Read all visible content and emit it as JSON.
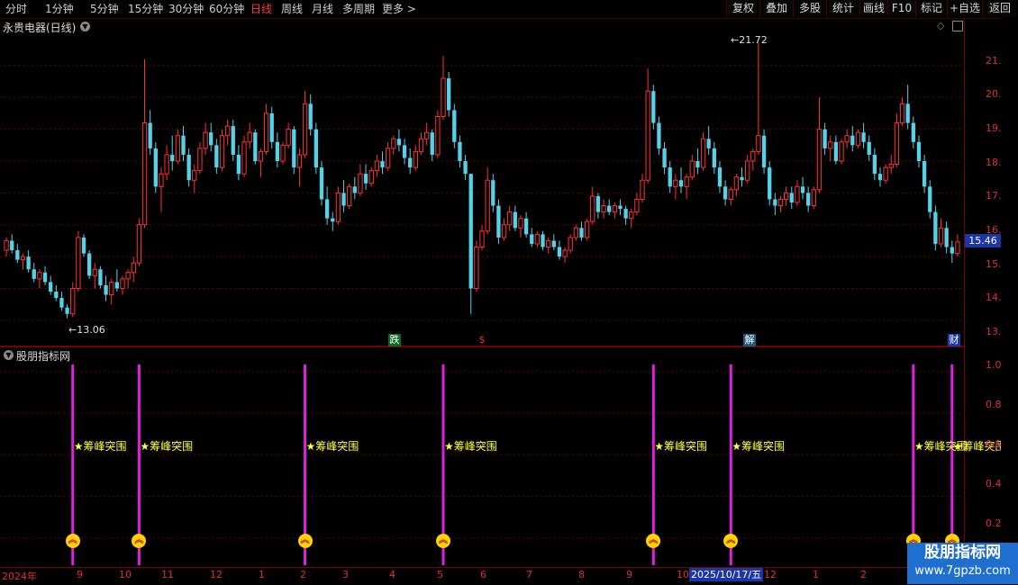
{
  "toolbar": {
    "timeframes": [
      "分时",
      "1分钟",
      "5分钟",
      "15分钟",
      "30分钟",
      "60分钟",
      "日线",
      "周线",
      "月线",
      "多周期",
      "更多"
    ],
    "active_timeframe": "日线",
    "buttons": [
      "复权",
      "叠加",
      "多股",
      "统计",
      "画线",
      "F10",
      "标记",
      "+自选",
      "返回"
    ]
  },
  "main_chart": {
    "stock_title": "永贵电器(日线)",
    "price_labels": [
      "21.00",
      "20.00",
      "19.00",
      "18.00",
      "17.00",
      "16.00",
      "15.00",
      "14.00",
      "13.00"
    ],
    "current_price": "15.46",
    "high_marker": "21.72",
    "low_marker": "13.06",
    "event_markers": [
      "跌",
      "$",
      "解",
      "财"
    ]
  },
  "indicator": {
    "title": "股朋指标网",
    "scale_labels": [
      "1.00",
      "0.80",
      "0.60",
      "0.40",
      "0.20"
    ],
    "signal_label": "★筹峰突围",
    "signal_count": 8
  },
  "x_axis": {
    "labels": [
      "2024年",
      "9",
      "10",
      "11",
      "12",
      "1",
      "2",
      "3",
      "4",
      "5",
      "6",
      "7",
      "8",
      "9",
      "10",
      "11",
      "12",
      "1",
      "2"
    ],
    "selected_date": "2025/10/17/五"
  },
  "watermark": {
    "line1": "股朋指标网",
    "line2": "www.7gpzb.com"
  },
  "colors": {
    "up": "#ff3232",
    "down": "#54d2e8",
    "signal": "#e020e0",
    "label": "#ffff40",
    "axis": "#e03030"
  },
  "chart_data": {
    "type": "candlestick",
    "title": "永贵电器(日线)",
    "y_range": [
      12.6,
      22.1
    ],
    "candles": [
      [
        15.2,
        15.6,
        15.0,
        15.5
      ],
      [
        15.5,
        15.7,
        15.1,
        15.2
      ],
      [
        15.2,
        15.4,
        14.8,
        14.9
      ],
      [
        14.9,
        15.1,
        14.6,
        15.0
      ],
      [
        15.0,
        15.2,
        14.5,
        14.6
      ],
      [
        14.6,
        14.8,
        14.2,
        14.3
      ],
      [
        14.3,
        14.6,
        14.0,
        14.5
      ],
      [
        14.5,
        14.7,
        14.1,
        14.2
      ],
      [
        14.2,
        14.4,
        13.8,
        13.9
      ],
      [
        13.9,
        14.1,
        13.6,
        13.7
      ],
      [
        13.7,
        13.9,
        13.3,
        13.4
      ],
      [
        13.4,
        13.5,
        13.06,
        13.2
      ],
      [
        13.2,
        14.2,
        13.1,
        14.0
      ],
      [
        14.0,
        15.8,
        13.9,
        15.6
      ],
      [
        15.6,
        15.7,
        15.0,
        15.1
      ],
      [
        15.1,
        15.2,
        14.3,
        14.4
      ],
      [
        14.4,
        14.8,
        14.0,
        14.6
      ],
      [
        14.6,
        14.7,
        14.0,
        14.1
      ],
      [
        14.1,
        14.4,
        13.6,
        13.8
      ],
      [
        13.8,
        14.3,
        13.5,
        14.2
      ],
      [
        14.2,
        14.6,
        13.9,
        14.0
      ],
      [
        14.0,
        14.4,
        13.8,
        14.3
      ],
      [
        14.3,
        14.6,
        14.0,
        14.5
      ],
      [
        14.5,
        15.0,
        14.2,
        14.8
      ],
      [
        14.8,
        16.2,
        14.7,
        16.0
      ],
      [
        16.0,
        21.2,
        15.9,
        19.2
      ],
      [
        19.2,
        19.6,
        18.2,
        18.4
      ],
      [
        18.4,
        18.6,
        17.0,
        17.2
      ],
      [
        17.2,
        17.8,
        16.4,
        17.6
      ],
      [
        17.6,
        18.5,
        17.4,
        18.2
      ],
      [
        18.2,
        18.8,
        17.7,
        18.0
      ],
      [
        18.0,
        19.0,
        17.9,
        18.8
      ],
      [
        18.8,
        19.1,
        18.0,
        18.2
      ],
      [
        18.2,
        18.4,
        17.2,
        17.4
      ],
      [
        17.4,
        17.9,
        17.0,
        17.7
      ],
      [
        17.7,
        18.6,
        17.6,
        18.4
      ],
      [
        18.4,
        19.2,
        18.2,
        18.9
      ],
      [
        18.9,
        19.2,
        18.3,
        18.5
      ],
      [
        18.5,
        18.7,
        17.6,
        17.8
      ],
      [
        17.8,
        19.0,
        17.7,
        18.8
      ],
      [
        18.8,
        19.3,
        18.5,
        19.1
      ],
      [
        19.1,
        19.3,
        18.0,
        18.2
      ],
      [
        18.2,
        18.5,
        17.4,
        17.6
      ],
      [
        17.6,
        18.8,
        17.5,
        18.6
      ],
      [
        18.6,
        19.2,
        18.4,
        18.9
      ],
      [
        18.9,
        19.0,
        17.9,
        18.0
      ],
      [
        18.0,
        18.4,
        17.5,
        18.3
      ],
      [
        18.3,
        19.8,
        18.2,
        19.5
      ],
      [
        19.5,
        19.7,
        18.4,
        18.6
      ],
      [
        18.6,
        18.9,
        17.8,
        18.0
      ],
      [
        18.0,
        18.6,
        17.9,
        18.5
      ],
      [
        18.5,
        19.2,
        18.4,
        19.0
      ],
      [
        19.0,
        19.1,
        17.6,
        17.8
      ],
      [
        17.8,
        18.4,
        17.2,
        18.2
      ],
      [
        18.2,
        20.2,
        18.1,
        19.8
      ],
      [
        19.8,
        20.1,
        18.8,
        19.0
      ],
      [
        19.0,
        19.2,
        17.6,
        17.8
      ],
      [
        17.8,
        18.0,
        16.6,
        16.8
      ],
      [
        16.8,
        17.2,
        16.0,
        16.2
      ],
      [
        16.2,
        16.4,
        15.8,
        16.1
      ],
      [
        16.1,
        17.2,
        16.0,
        17.0
      ],
      [
        17.0,
        17.4,
        16.4,
        16.6
      ],
      [
        16.6,
        17.3,
        16.5,
        17.2
      ],
      [
        17.2,
        17.5,
        16.8,
        17.0
      ],
      [
        17.0,
        17.9,
        16.9,
        17.6
      ],
      [
        17.6,
        17.9,
        17.1,
        17.3
      ],
      [
        17.3,
        17.8,
        17.2,
        17.7
      ],
      [
        17.7,
        18.2,
        17.5,
        18.0
      ],
      [
        18.0,
        18.3,
        17.6,
        17.8
      ],
      [
        17.8,
        18.6,
        17.7,
        18.4
      ],
      [
        18.4,
        18.8,
        18.2,
        18.7
      ],
      [
        18.7,
        19.0,
        18.3,
        18.5
      ],
      [
        18.5,
        18.7,
        17.9,
        18.1
      ],
      [
        18.1,
        18.4,
        17.6,
        17.8
      ],
      [
        17.8,
        18.5,
        17.7,
        18.3
      ],
      [
        18.3,
        18.9,
        18.2,
        18.7
      ],
      [
        18.7,
        19.2,
        18.5,
        18.9
      ],
      [
        18.9,
        19.0,
        18.0,
        18.2
      ],
      [
        18.2,
        19.6,
        18.1,
        19.4
      ],
      [
        19.4,
        21.3,
        19.3,
        20.6
      ],
      [
        20.6,
        20.8,
        19.4,
        19.6
      ],
      [
        19.6,
        19.8,
        18.4,
        18.6
      ],
      [
        18.6,
        18.8,
        17.8,
        18.0
      ],
      [
        18.0,
        18.2,
        17.4,
        17.6
      ],
      [
        17.6,
        15.8,
        13.2,
        14.0
      ],
      [
        14.0,
        15.5,
        13.9,
        15.3
      ],
      [
        15.3,
        16.0,
        15.2,
        15.8
      ],
      [
        15.8,
        17.8,
        15.7,
        17.4
      ],
      [
        17.4,
        17.6,
        16.4,
        16.6
      ],
      [
        16.6,
        16.8,
        15.4,
        15.6
      ],
      [
        15.6,
        16.2,
        15.5,
        16.0
      ],
      [
        16.0,
        16.6,
        15.8,
        16.4
      ],
      [
        16.4,
        16.6,
        15.8,
        15.9
      ],
      [
        15.9,
        16.3,
        15.6,
        16.2
      ],
      [
        16.2,
        16.4,
        15.6,
        15.7
      ],
      [
        15.7,
        15.9,
        15.3,
        15.4
      ],
      [
        15.4,
        15.8,
        15.3,
        15.7
      ],
      [
        15.7,
        15.8,
        15.2,
        15.3
      ],
      [
        15.3,
        15.6,
        15.1,
        15.5
      ],
      [
        15.5,
        15.7,
        15.2,
        15.3
      ],
      [
        15.3,
        15.5,
        14.9,
        15.0
      ],
      [
        15.0,
        15.3,
        14.8,
        15.2
      ],
      [
        15.2,
        15.7,
        15.1,
        15.6
      ],
      [
        15.6,
        16.0,
        15.5,
        15.9
      ],
      [
        15.9,
        16.1,
        15.5,
        15.6
      ],
      [
        15.6,
        16.2,
        15.5,
        16.1
      ],
      [
        16.1,
        17.2,
        16.0,
        16.9
      ],
      [
        16.9,
        17.0,
        16.2,
        16.4
      ],
      [
        16.4,
        16.8,
        16.2,
        16.6
      ],
      [
        16.6,
        16.8,
        16.3,
        16.4
      ],
      [
        16.4,
        16.7,
        16.2,
        16.6
      ],
      [
        16.6,
        16.8,
        16.3,
        16.5
      ],
      [
        16.5,
        16.6,
        16.0,
        16.2
      ],
      [
        16.2,
        16.5,
        15.9,
        16.4
      ],
      [
        16.4,
        17.0,
        16.3,
        16.8
      ],
      [
        16.8,
        17.6,
        16.7,
        17.4
      ],
      [
        17.4,
        20.9,
        17.3,
        20.2
      ],
      [
        20.2,
        20.4,
        19.0,
        19.2
      ],
      [
        19.2,
        19.4,
        18.2,
        18.4
      ],
      [
        18.4,
        18.6,
        17.6,
        17.8
      ],
      [
        17.8,
        18.0,
        17.0,
        17.2
      ],
      [
        17.2,
        17.6,
        16.8,
        17.4
      ],
      [
        17.4,
        17.8,
        17.0,
        17.2
      ],
      [
        17.2,
        17.6,
        16.8,
        17.5
      ],
      [
        17.5,
        18.2,
        17.4,
        18.0
      ],
      [
        18.0,
        18.4,
        17.6,
        17.8
      ],
      [
        17.8,
        18.9,
        17.7,
        18.7
      ],
      [
        18.7,
        19.1,
        18.2,
        18.4
      ],
      [
        18.4,
        18.6,
        17.6,
        17.8
      ],
      [
        17.8,
        18.0,
        17.0,
        17.2
      ],
      [
        17.2,
        17.4,
        16.6,
        16.8
      ],
      [
        16.8,
        17.2,
        16.6,
        17.1
      ],
      [
        17.1,
        17.6,
        16.9,
        17.5
      ],
      [
        17.5,
        17.8,
        17.2,
        17.4
      ],
      [
        17.4,
        18.2,
        17.3,
        18.0
      ],
      [
        18.0,
        18.4,
        17.7,
        18.3
      ],
      [
        18.3,
        21.72,
        18.2,
        18.8
      ],
      [
        18.8,
        19.0,
        17.6,
        17.8
      ],
      [
        17.8,
        18.0,
        16.6,
        16.8
      ],
      [
        16.8,
        17.0,
        16.3,
        16.6
      ],
      [
        16.6,
        16.9,
        16.4,
        16.8
      ],
      [
        16.8,
        17.2,
        16.6,
        17.0
      ],
      [
        17.0,
        17.2,
        16.5,
        16.7
      ],
      [
        16.7,
        17.4,
        16.6,
        17.2
      ],
      [
        17.2,
        17.5,
        16.8,
        17.0
      ],
      [
        17.0,
        17.2,
        16.4,
        16.6
      ],
      [
        16.6,
        17.2,
        16.5,
        17.1
      ],
      [
        17.1,
        20.0,
        17.0,
        19.0
      ],
      [
        19.0,
        19.2,
        18.2,
        18.4
      ],
      [
        18.4,
        18.8,
        18.0,
        18.6
      ],
      [
        18.6,
        18.8,
        17.9,
        18.0
      ],
      [
        18.0,
        18.7,
        17.9,
        18.6
      ],
      [
        18.6,
        19.0,
        18.4,
        18.8
      ],
      [
        18.8,
        19.1,
        18.3,
        18.5
      ],
      [
        18.5,
        19.0,
        18.4,
        18.9
      ],
      [
        18.9,
        19.2,
        18.4,
        18.6
      ],
      [
        18.6,
        18.8,
        18.0,
        18.2
      ],
      [
        18.2,
        18.4,
        17.4,
        17.6
      ],
      [
        17.6,
        17.8,
        17.2,
        17.4
      ],
      [
        17.4,
        17.9,
        17.3,
        17.8
      ],
      [
        17.8,
        18.2,
        17.6,
        17.9
      ],
      [
        17.9,
        19.5,
        17.8,
        19.2
      ],
      [
        19.2,
        20.0,
        19.1,
        19.8
      ],
      [
        19.8,
        20.4,
        19.0,
        19.2
      ],
      [
        19.2,
        19.4,
        18.4,
        18.6
      ],
      [
        18.6,
        18.8,
        17.8,
        18.0
      ],
      [
        18.0,
        18.2,
        17.0,
        17.2
      ],
      [
        17.2,
        17.4,
        16.2,
        16.4
      ],
      [
        16.4,
        16.6,
        15.2,
        15.4
      ],
      [
        15.4,
        16.2,
        15.3,
        15.9
      ],
      [
        15.9,
        16.1,
        15.1,
        15.3
      ],
      [
        15.3,
        15.5,
        14.8,
        15.1
      ],
      [
        15.1,
        15.7,
        15.0,
        15.46
      ]
    ],
    "signal_indices": [
      12,
      24,
      54,
      79,
      117,
      131,
      164,
      171
    ],
    "signal_value": 0.65,
    "indicator_range": [
      0.13,
      1.06
    ]
  }
}
